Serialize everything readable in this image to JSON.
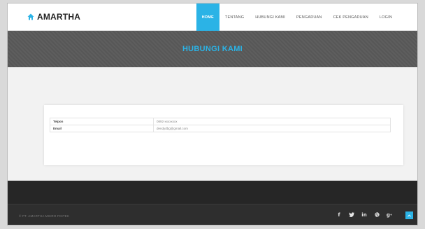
{
  "brand": {
    "name": "AMARTHA",
    "icon": "home-icon",
    "accent": "#2bb3e6"
  },
  "nav": {
    "items": [
      {
        "label": "HOME",
        "active": true
      },
      {
        "label": "TENTANG"
      },
      {
        "label": "HUBUNGI KAMI"
      },
      {
        "label": "PENGADUAN"
      },
      {
        "label": "CEK PENGADUAN"
      },
      {
        "label": "LOGIN"
      }
    ]
  },
  "header": {
    "title": "HUBUNGI KAMI"
  },
  "contact": {
    "rows": [
      {
        "label": "Telpon",
        "value": "0892-xxxxxxxx"
      },
      {
        "label": "Email",
        "value": "dendydbg@gmail.com"
      }
    ]
  },
  "footer": {
    "copyright": "© PT. AMARTHA MIKRO FINTEK",
    "socials": [
      "facebook-icon",
      "twitter-icon",
      "linkedin-icon",
      "dribbble-icon",
      "google-plus-icon"
    ],
    "back_to_top_icon": "chevron-up-icon"
  }
}
